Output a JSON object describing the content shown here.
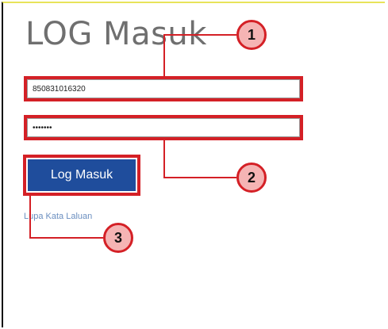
{
  "login": {
    "title": "LOG Masuk",
    "username_value": "850831016320",
    "password_value": "•••••••",
    "button_label": "Log Masuk",
    "forgot_link": "Lupa Kata Laluan"
  },
  "callouts": [
    "1",
    "2",
    "3"
  ],
  "colors": {
    "highlight": "#d42026",
    "button": "#1f4d9c",
    "badge_fill": "#f5b4b4"
  }
}
